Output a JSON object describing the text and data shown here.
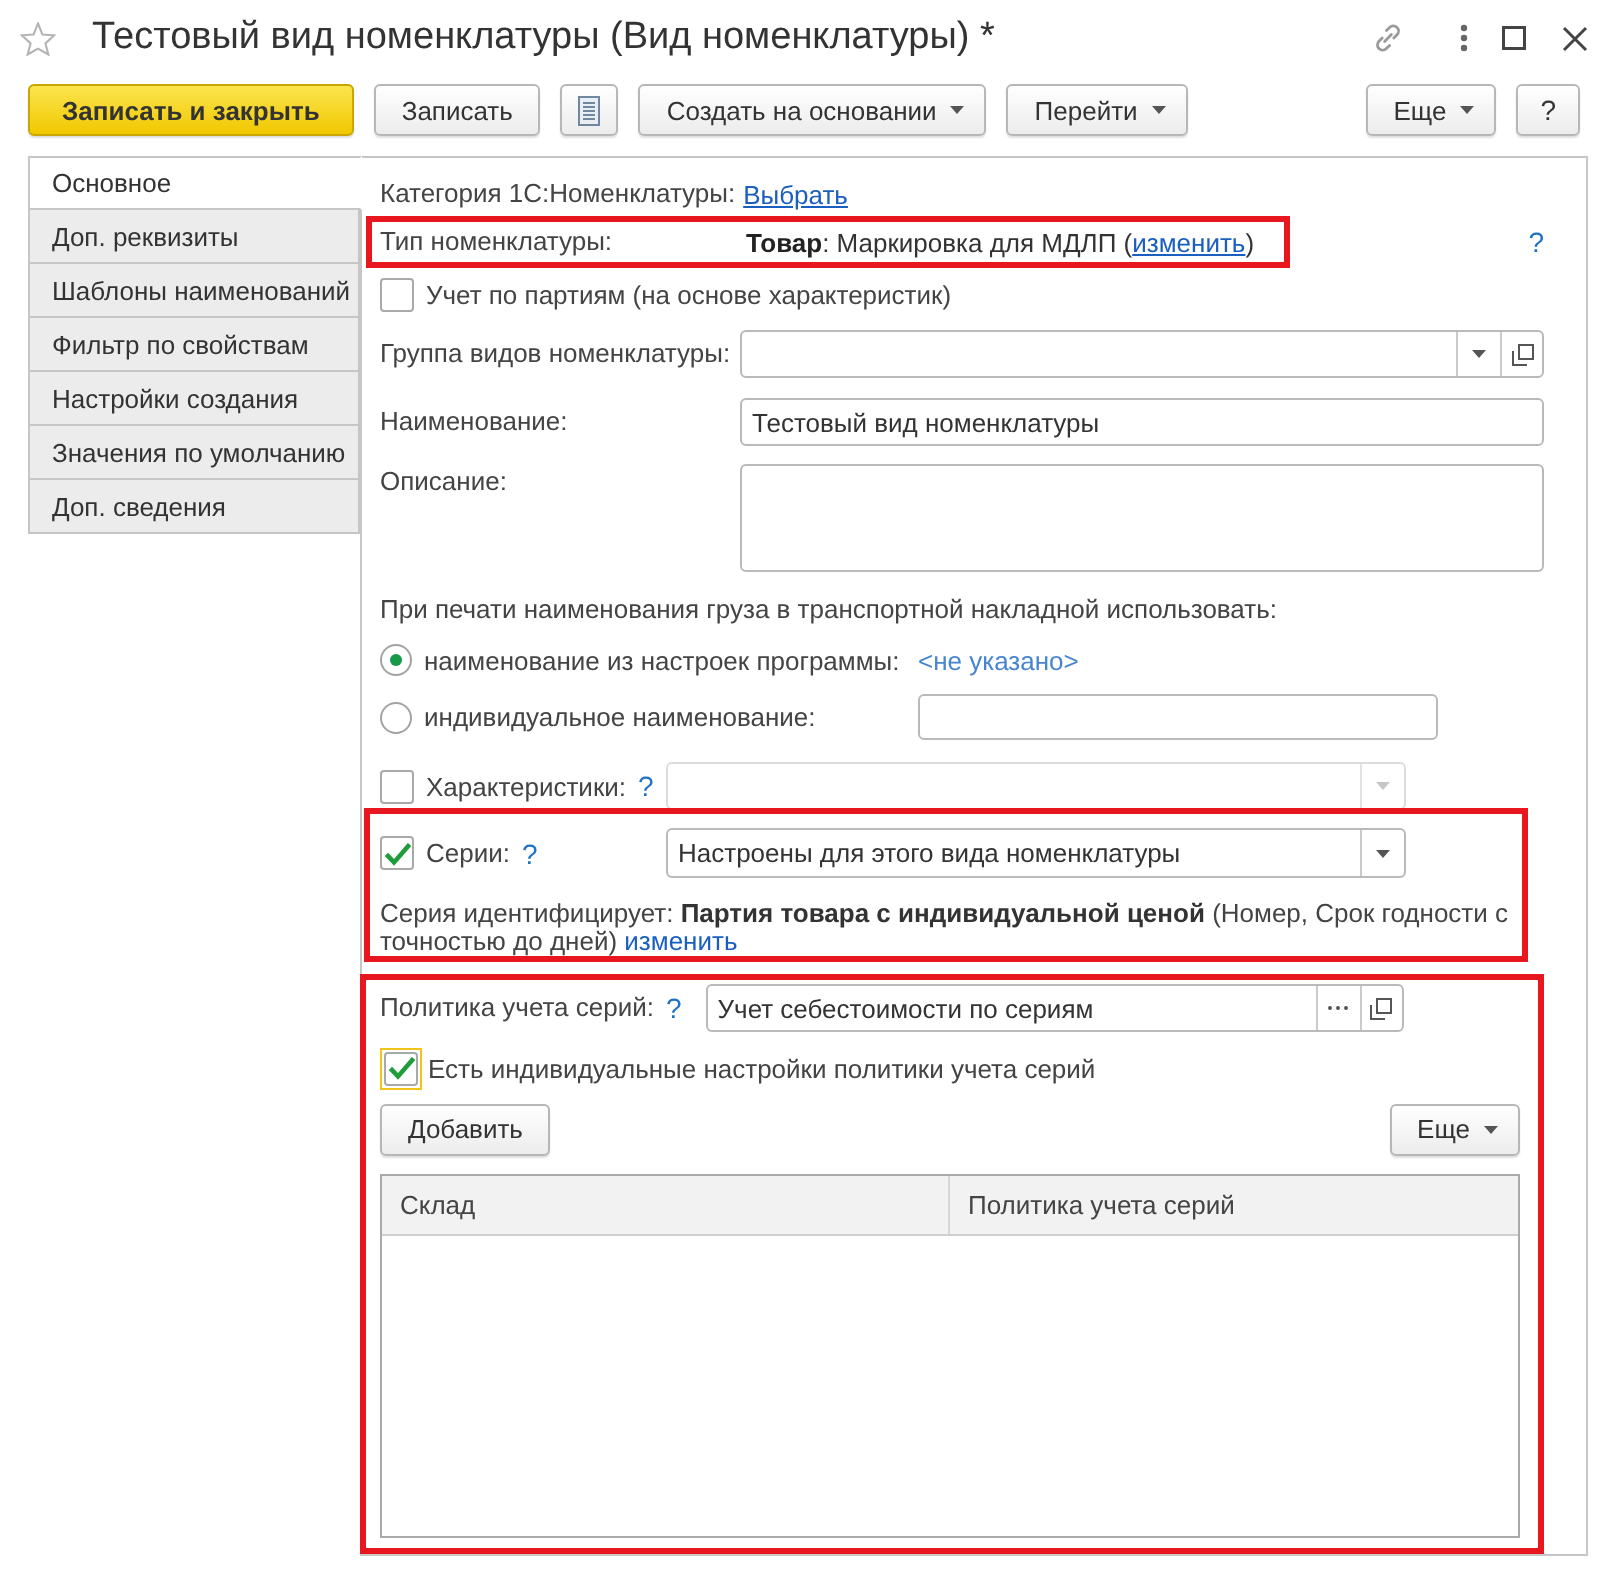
{
  "window": {
    "title": "Тестовый вид номенклатуры (Вид номенклатуры) *"
  },
  "toolbar": {
    "left": [
      {
        "kind": "primary",
        "label": "Записать и закрыть"
      },
      {
        "kind": "plain",
        "label": "Записать"
      },
      {
        "kind": "icon"
      },
      {
        "kind": "menu",
        "label": "Создать на основании"
      },
      {
        "kind": "menu",
        "label": "Перейти"
      }
    ],
    "right": [
      {
        "kind": "menu",
        "label": "Еще"
      },
      {
        "kind": "help",
        "label": "?"
      }
    ]
  },
  "tabs": [
    {
      "label": "Основное",
      "selected": true
    },
    {
      "label": "Доп. реквизиты",
      "selected": false
    },
    {
      "label": "Шаблоны наименований",
      "selected": false
    },
    {
      "label": "Фильтр по свойствам",
      "selected": false
    },
    {
      "label": "Настройки создания",
      "selected": false
    },
    {
      "label": "Значения по умолчанию",
      "selected": false
    },
    {
      "label": "Доп. сведения",
      "selected": false
    }
  ],
  "form": {
    "category": {
      "label": "Категория 1С:Номенклатуры:",
      "link": "Выбрать"
    },
    "item_type": {
      "highlighted": true,
      "label": "Тип номенклатуры:",
      "value": "**Товар**: Маркировка для МДЛП (",
      "link": "изменить",
      "value_end": ")",
      "help": "?"
    },
    "batch_accounting": {
      "label": "Учет по партиям (на основе характеристик)",
      "checked": false
    },
    "group": {
      "label": "Группа видов номенклатуры:"
    },
    "name": {
      "label": "Наименование:",
      "value": "Тестовый вид номенклатуры"
    },
    "description": {
      "label": "Описание:"
    },
    "print_name": {
      "label": "При печати наименования груза в транспортной накладной использовать:",
      "options": [
        {
          "kind": "text",
          "label": "наименование из настроек программы:",
          "selected": true,
          "value": "<не указано>"
        },
        {
          "kind": "field",
          "label": "индивидуальное наименование:",
          "selected": false
        }
      ]
    },
    "characteristics": {
      "label": "Характеристики:",
      "checked": false,
      "help": "?",
      "disabled": true
    },
    "series": {
      "highlighted": true,
      "label": "Серии:",
      "checked": true,
      "help": "?",
      "value": "Настроены для этого вида номенклатуры",
      "disabled": false,
      "note": "Серия идентифицирует: **Партия товара с индивидуальной ценой** (Номер, Срок годности с точностью до дней)",
      "note_link": "изменить"
    },
    "series_policy": {
      "highlighted": true,
      "label": "Политика учета серий:",
      "help": "?",
      "value": "Учет себестоимости по сериям",
      "custom_settings": {
        "label": "Есть индивидуальные настройки политики учета серий",
        "checked": true,
        "focused": true
      },
      "buttons": [
        {
          "kind": "plain",
          "label": "Добавить"
        },
        {
          "kind": "menu",
          "label": "Еще"
        }
      ],
      "table": {
        "columns": [
          "Склад",
          "Политика учета серий"
        ]
      }
    }
  }
}
